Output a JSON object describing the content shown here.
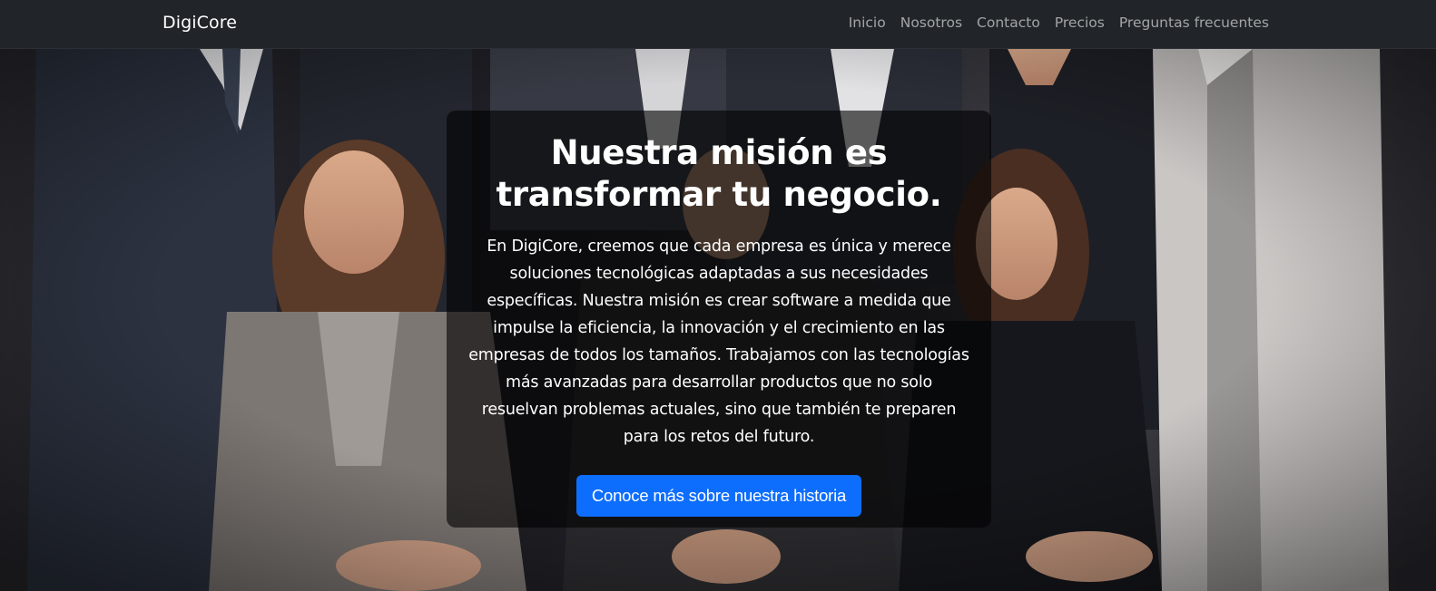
{
  "navbar": {
    "brand": "DigiCore",
    "links": [
      "Inicio",
      "Nosotros",
      "Contacto",
      "Precios",
      "Preguntas frecuentes"
    ]
  },
  "hero": {
    "title": "Nuestra misión es transformar tu negocio.",
    "body": "En DigiCore, creemos que cada empresa es única y merece soluciones tecnológicas adaptadas a sus necesidades específicas. Nuestra misión es crear software a medida que impulse la eficiencia, la innovación y el crecimiento en las empresas de todos los tamaños. Trabajamos con las tecnologías más avanzadas para desarrollar productos que no solo resuelvan problemas actuales, sino que también te preparen para los retos del futuro.",
    "cta_label": "Conoce más sobre nuestra historia"
  },
  "colors": {
    "navbar_bg": "#212529",
    "cta_bg": "#0d6efd",
    "text": "#ffffff",
    "nav_link": "rgba(255,255,255,0.55)"
  }
}
